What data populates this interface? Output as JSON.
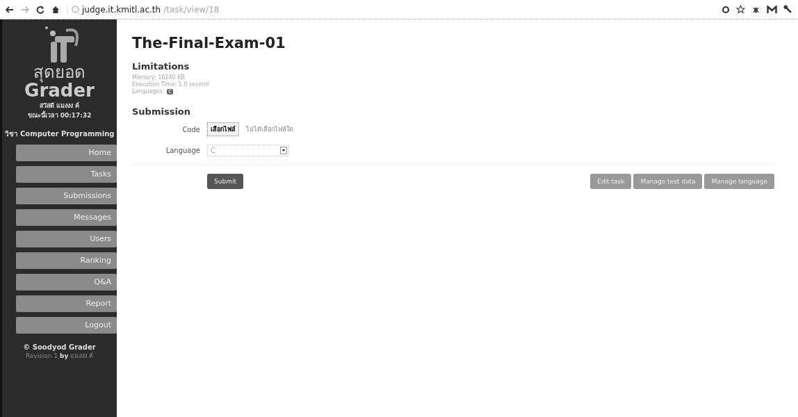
{
  "browser": {
    "url_host": "judge.it.kmitl.ac.th",
    "url_path": "/task/view/18"
  },
  "sidebar": {
    "logo_thai": "สุดยอด",
    "logo_name": "Grader",
    "greeting": "สวัสดี แมงงง ค์",
    "clock": "ขณะนี้เวลา 00:17:32",
    "course": "วิชา Computer Programming",
    "items": [
      {
        "label": "Home"
      },
      {
        "label": "Tasks"
      },
      {
        "label": "Submissions"
      },
      {
        "label": "Messages"
      },
      {
        "label": "Users"
      },
      {
        "label": "Ranking"
      },
      {
        "label": "Q&A"
      },
      {
        "label": "Report"
      },
      {
        "label": "Logout"
      }
    ],
    "footer": "© Soodyod Grader",
    "revision": "Revision 1",
    "revision_by": "by",
    "revision_author": "แมงงง.ค์"
  },
  "task": {
    "title": "The-Final-Exam-01",
    "limitations_heading": "Limitations",
    "memory": "Memory: 16240 KB",
    "time": "Execution Time: 1.0 second",
    "languages_label": "Languages:",
    "languages": [
      "C"
    ],
    "submission_heading": "Submission",
    "code_label": "Code",
    "file_button": "เลือกไฟล์",
    "file_status": "ไม่ได้เลือกไฟล์ใด",
    "language_label": "Language",
    "language_value": "C",
    "submit": "Submit",
    "actions": [
      "Edit task",
      "Manage test data",
      "Manage language"
    ]
  }
}
